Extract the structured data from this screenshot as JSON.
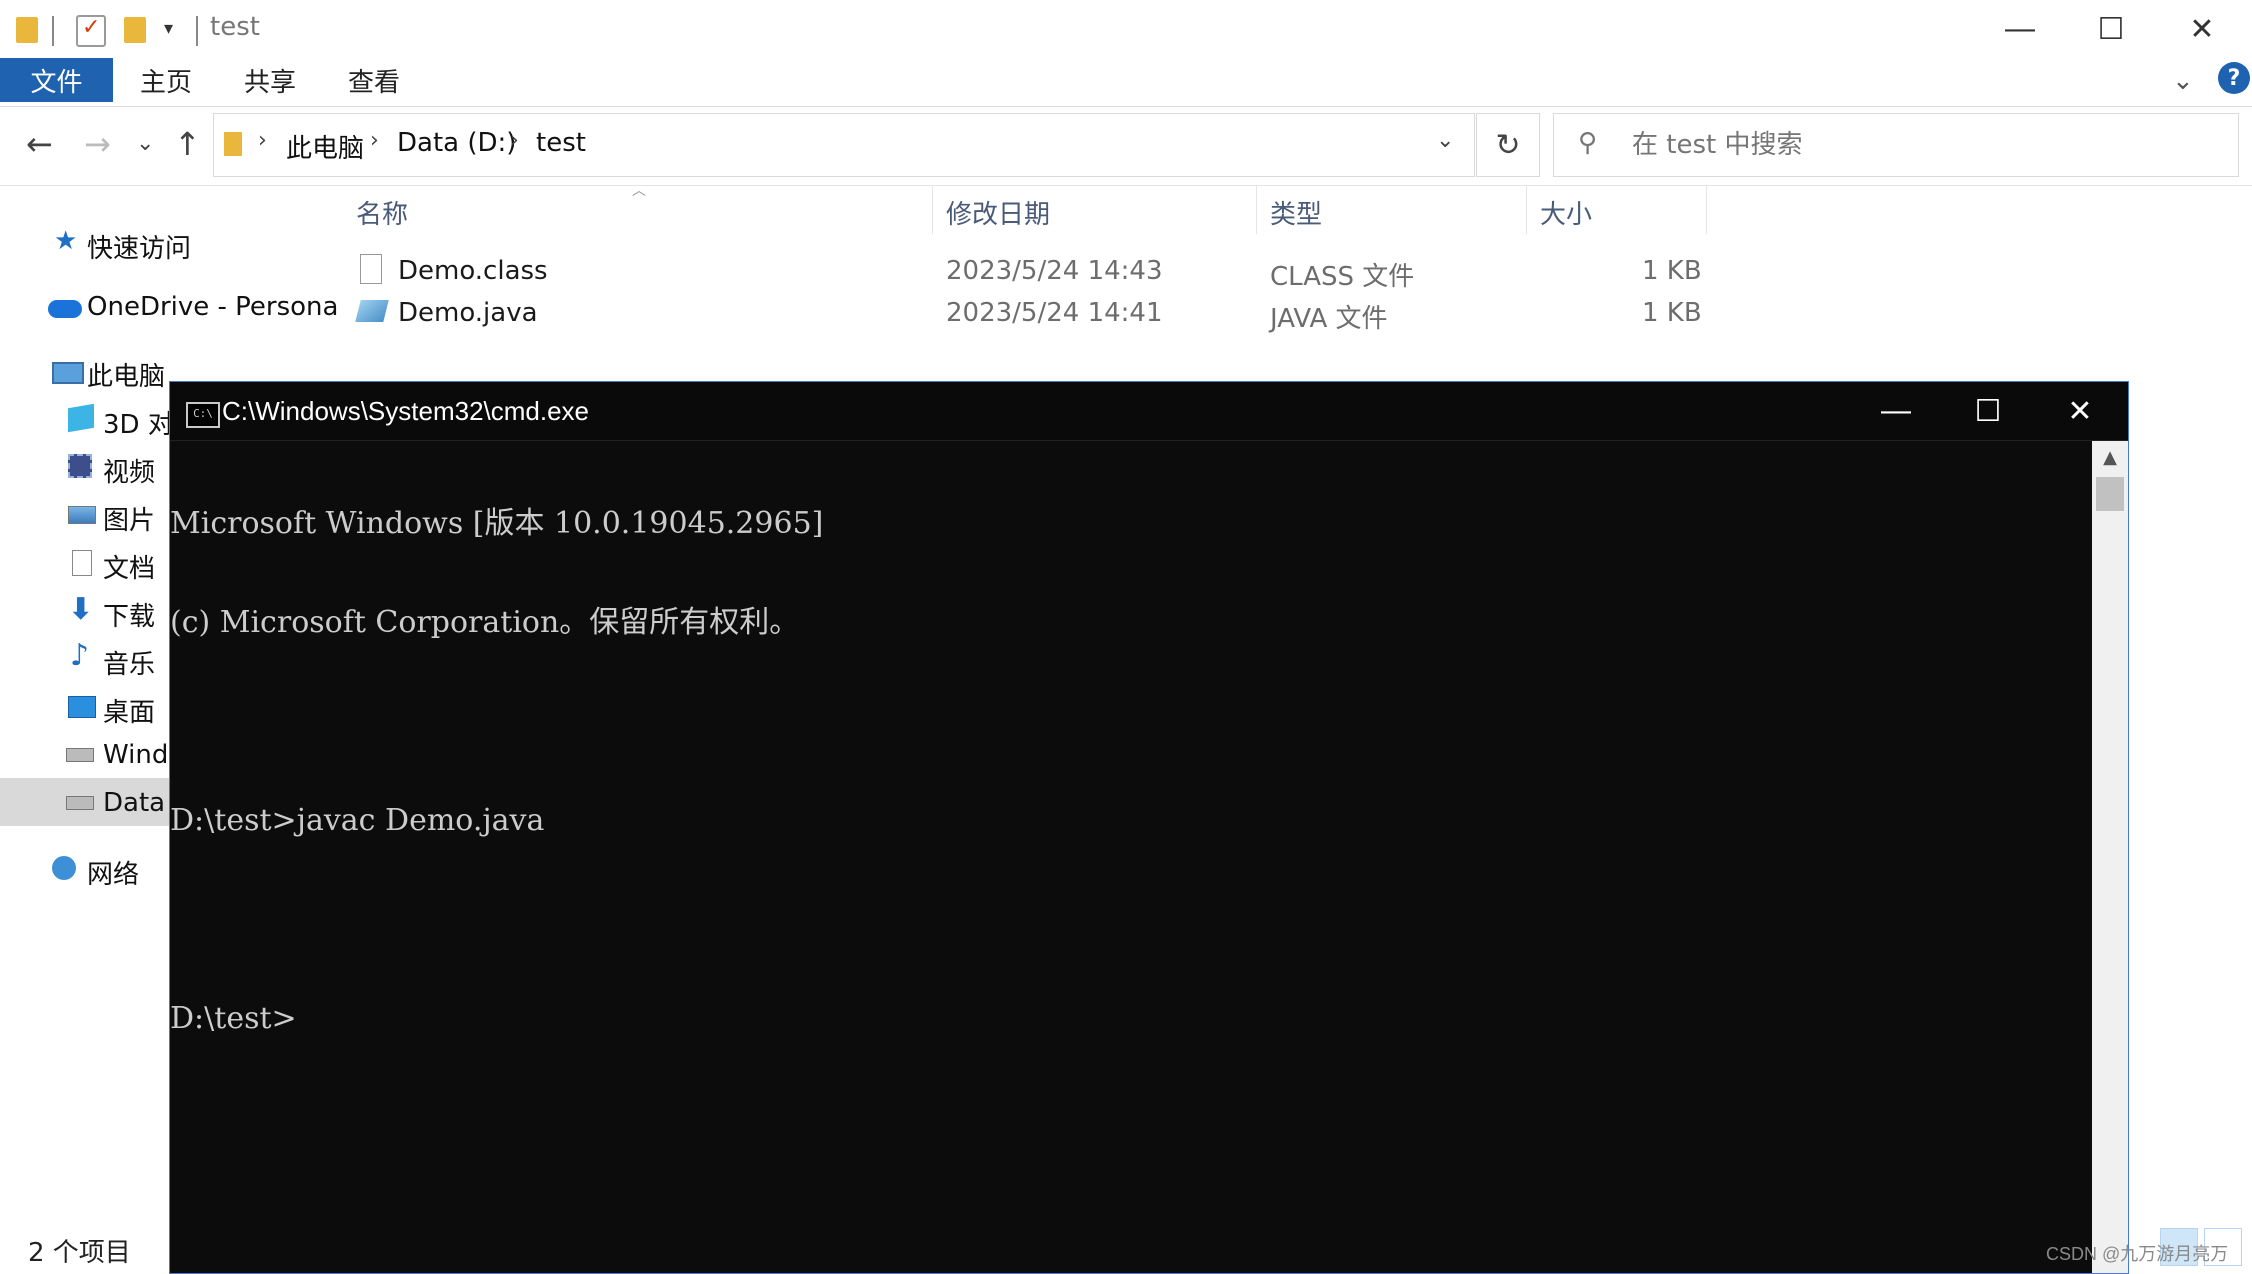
{
  "explorer": {
    "window_title": "test",
    "ribbon_tabs": [
      "文件",
      "主页",
      "共享",
      "查看"
    ],
    "address": {
      "crumbs": [
        "此电脑",
        "Data (D:)",
        "test"
      ]
    },
    "search": {
      "placeholder": "在 test 中搜索"
    },
    "sidebar": {
      "quick_access": "快速访问",
      "onedrive": "OneDrive - Persona",
      "this_pc": "此电脑",
      "items": [
        "3D 对",
        "视频",
        "图片",
        "文档",
        "下载",
        "音乐",
        "桌面",
        "Windo",
        "Data ("
      ],
      "network": "网络"
    },
    "columns": {
      "name": "名称",
      "modified": "修改日期",
      "type": "类型",
      "size": "大小"
    },
    "files": [
      {
        "name": "Demo.class",
        "modified": "2023/5/24 14:43",
        "type": "CLASS 文件",
        "size": "1 KB",
        "icon": "blank-file-icon"
      },
      {
        "name": "Demo.java",
        "modified": "2023/5/24 14:41",
        "type": "JAVA 文件",
        "size": "1 KB",
        "icon": "java-file-icon"
      }
    ],
    "status": "2 个项目"
  },
  "cmd": {
    "title": "C:\\Windows\\System32\\cmd.exe",
    "icon_text": "C:\\",
    "lines": [
      "Microsoft Windows [版本 10.0.19045.2965]",
      "(c) Microsoft Corporation。保留所有权利。",
      "",
      "D:\\test>javac Demo.java",
      "",
      "D:\\test>"
    ]
  },
  "watermark": "CSDN @九万游月亮万",
  "colors": {
    "accent": "#1f62b0",
    "console_bg": "#0c0c0c",
    "console_fg": "#cccccc",
    "folder": "#e8b73c"
  }
}
